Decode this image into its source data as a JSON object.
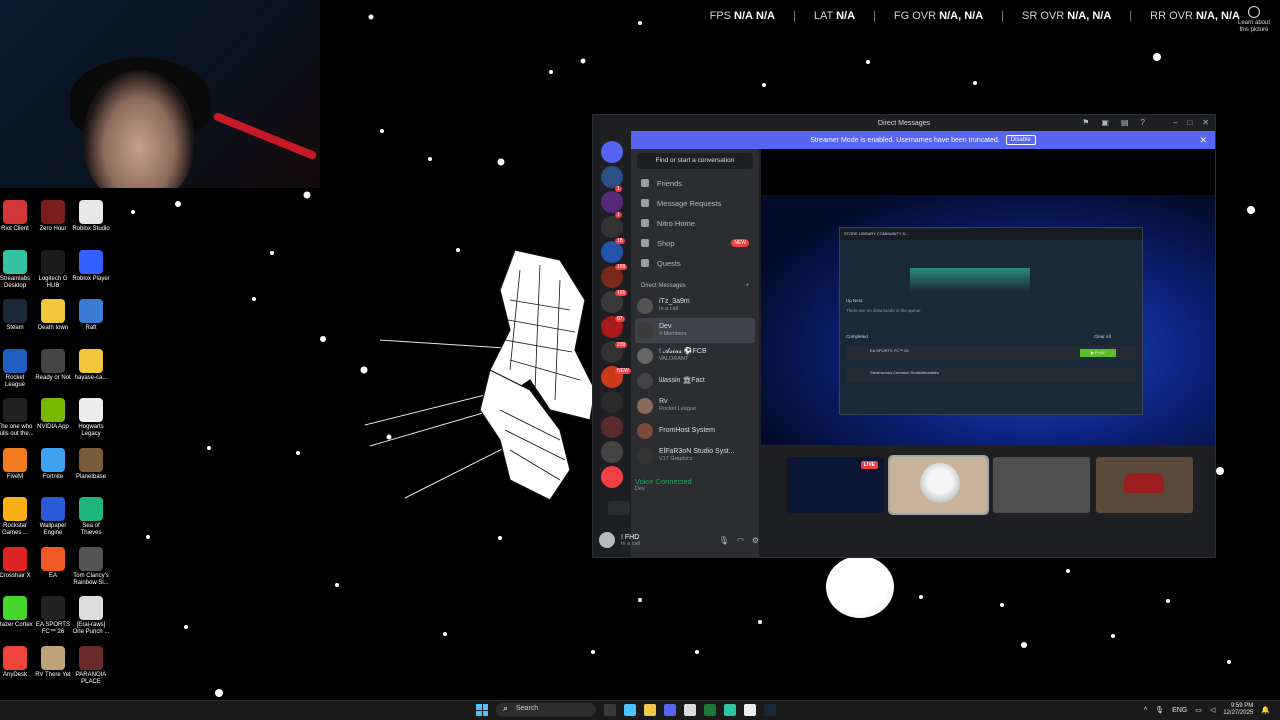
{
  "hud": {
    "stats": [
      {
        "key": "FPS",
        "v1": "N/A",
        "v2": "N/A"
      },
      {
        "key": "LAT",
        "v1": "N/A",
        "v2": ""
      },
      {
        "key": "FG OVR",
        "v1": "N/A,",
        "v2": "N/A"
      },
      {
        "key": "SR OVR",
        "v1": "N/A,",
        "v2": "N/A"
      },
      {
        "key": "RR OVR",
        "v1": "N/A,",
        "v2": "N/A"
      }
    ],
    "learn_more": "Learn about this picture"
  },
  "desktop_icons": [
    {
      "label": "Riot Client",
      "color": "#d13639"
    },
    {
      "label": "Zero Hour",
      "color": "#7a1d1d"
    },
    {
      "label": "Roblox Studio",
      "color": "#e8e8e8"
    },
    {
      "label": "Streamlabs Desktop",
      "color": "#31c3a2"
    },
    {
      "label": "Logitech G HUB",
      "color": "#1b1b1b"
    },
    {
      "label": "Roblox Player",
      "color": "#335fff"
    },
    {
      "label": "Steam",
      "color": "#1b2838"
    },
    {
      "label": "Death town",
      "color": "#f3c83c"
    },
    {
      "label": "Raft",
      "color": "#3a7bd5"
    },
    {
      "label": "Rocket League",
      "color": "#1f5fbf"
    },
    {
      "label": "Ready or Not",
      "color": "#444444"
    },
    {
      "label": "hayase-ca...",
      "color": "#f3c83c"
    },
    {
      "label": "The one who pulls out the...",
      "color": "#222222"
    },
    {
      "label": "NVIDIA App",
      "color": "#76b900"
    },
    {
      "label": "Hogwarts Legacy",
      "color": "#eeeeee"
    },
    {
      "label": "FiveM",
      "color": "#f47b20"
    },
    {
      "label": "Fortnite",
      "color": "#3ea1f2"
    },
    {
      "label": "Planetbase",
      "color": "#7a5c3a"
    },
    {
      "label": "Rockstar Games ...",
      "color": "#fcaf17"
    },
    {
      "label": "Wallpaper Engine",
      "color": "#2a5bd7"
    },
    {
      "label": "Sea of Thieves",
      "color": "#1db57a"
    },
    {
      "label": "Crosshair X",
      "color": "#e02424"
    },
    {
      "label": "EA",
      "color": "#f15a24"
    },
    {
      "label": "Tom Clancy's Rainbow Si...",
      "color": "#555555"
    },
    {
      "label": "Razer Cortex",
      "color": "#44d62c"
    },
    {
      "label": "EA SPORTS FC™ 26",
      "color": "#222222"
    },
    {
      "label": "[Erai-raws] One Punch ...",
      "color": "#dddddd"
    },
    {
      "label": "AnyDesk",
      "color": "#ef443b"
    },
    {
      "label": "RV There Yet",
      "color": "#c0a27a"
    },
    {
      "label": "PARANOIA PLACE",
      "color": "#6b2a2a"
    }
  ],
  "discord": {
    "title": "Direct Messages",
    "banner_text": "Streamer Mode is enabled. Usernames have been truncated.",
    "banner_button": "Disable",
    "find_placeholder": "Find or start a conversation",
    "nav": [
      {
        "label": "Friends",
        "badge": ""
      },
      {
        "label": "Message Requests",
        "badge": ""
      },
      {
        "label": "Nitro Home",
        "badge": ""
      },
      {
        "label": "Shop",
        "badge": "NEW"
      },
      {
        "label": "Quests",
        "badge": ""
      }
    ],
    "dm_header": "Direct Messages",
    "dm_add": "+",
    "dms": [
      {
        "name": "iTz_3a9m",
        "sub": "In a call",
        "color": "#555"
      },
      {
        "name": "Dev",
        "sub": "4 Members",
        "color": "#3a3a3a"
      },
      {
        "name": "! 𝓐𝓼𝓲𝓪𝓼 ⚽FCB",
        "sub": "VALORANT",
        "color": "#666"
      },
      {
        "name": "ᗯassin 🏛Fact",
        "sub": "",
        "color": "#444"
      },
      {
        "name": "Rv",
        "sub": "Rocket League",
        "color": "#8a6a5a"
      },
      {
        "name": "FromHost System",
        "sub": "",
        "color": "#7a4a3a"
      },
      {
        "name": "ElFaR3oN Studio Syst...",
        "sub": "V17 Graphics",
        "color": "#333"
      }
    ],
    "voice_status": "Voice Connected",
    "voice_channel": "Dev",
    "user_name": "! FHD",
    "user_status": "In a call",
    "server_badges": [
      "1",
      "1",
      "18",
      "199",
      "101",
      "97",
      "239",
      "NEW"
    ],
    "live_label": "LIVE",
    "screenshare": {
      "tabs": "STORE   LIBRARY   COMMUNITY   N...",
      "upnext": "Up Next",
      "upnext_sub": "There are no downloads in the queue",
      "completed": "Completed",
      "clear_all": "Clear All",
      "game1": "EA SPORTS FC™ 26",
      "play": "▶ PLAY",
      "game2": "Steamworks Common Redistributables"
    }
  },
  "taskbar": {
    "search_placeholder": "Search",
    "lang": "ENG",
    "time": "9:59 PM",
    "date": "12/27/2025"
  }
}
